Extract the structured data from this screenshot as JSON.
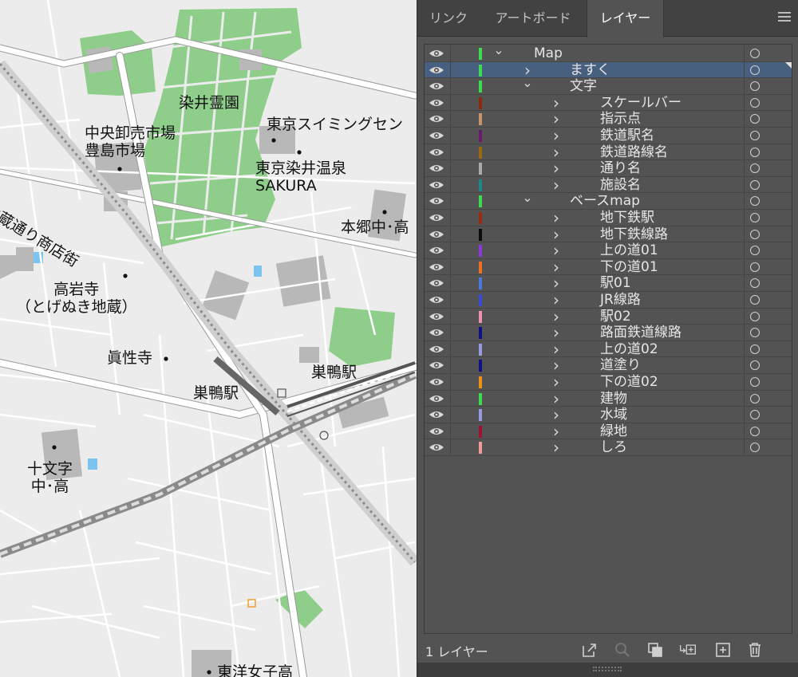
{
  "map": {
    "labels": {
      "somei_reien": "染井霊園",
      "tokyo_swimming": "東京スイミングセン",
      "chuo_oroshiuri": "中央卸売市場\n豊島市場",
      "tokyo_somei_onsen": "東京染井温泉\nSAKURA",
      "jizo_dori": "地蔵通り商店街",
      "hongo": "本郷中･高",
      "koganji": "高岩寺\n（とげぬき地蔵）",
      "shinshoji": "眞性寺",
      "sugamo_station_jr": "巣鴨駅",
      "sugamo_station_subway": "巣鴨駅",
      "jumonji": "十文字\n中･高",
      "toyo_joshi": "東洋女子高"
    }
  },
  "panel": {
    "tabs": [
      "リンク",
      "アートボード",
      "レイヤー"
    ],
    "active_tab": "レイヤー",
    "layer_count": "1 レイヤー",
    "layers": [
      {
        "name": "Map",
        "level": 0,
        "expanded": true,
        "color": "#3ddc4e",
        "selected": false
      },
      {
        "name": "ますく",
        "level": 1,
        "expanded": false,
        "color": "#3ddc4e",
        "selected": true
      },
      {
        "name": "文字",
        "level": 1,
        "expanded": true,
        "color": "#3ddc4e",
        "selected": false
      },
      {
        "name": "スケールバー",
        "level": 2,
        "expanded": false,
        "color": "#8b2a10",
        "selected": false
      },
      {
        "name": "指示点",
        "level": 2,
        "expanded": false,
        "color": "#c8926a",
        "selected": false
      },
      {
        "name": "鉄道駅名",
        "level": 2,
        "expanded": false,
        "color": "#6a1a6a",
        "selected": false
      },
      {
        "name": "鉄道路線名",
        "level": 2,
        "expanded": false,
        "color": "#9a6a10",
        "selected": false
      },
      {
        "name": "通り名",
        "level": 2,
        "expanded": false,
        "color": "#aaaaaa",
        "selected": false
      },
      {
        "name": "施設名",
        "level": 2,
        "expanded": false,
        "color": "#1a8a8a",
        "selected": false
      },
      {
        "name": "ベースmap",
        "level": 1,
        "expanded": true,
        "color": "#3ddc4e",
        "selected": false
      },
      {
        "name": "地下鉄駅",
        "level": 2,
        "expanded": false,
        "color": "#9a2a10",
        "selected": false
      },
      {
        "name": "地下鉄線路",
        "level": 2,
        "expanded": false,
        "color": "#0a0a0a",
        "selected": false
      },
      {
        "name": "上の道01",
        "level": 2,
        "expanded": false,
        "color": "#8a3ad8",
        "selected": false
      },
      {
        "name": "下の道01",
        "level": 2,
        "expanded": false,
        "color": "#f07020",
        "selected": false
      },
      {
        "name": "駅01",
        "level": 2,
        "expanded": false,
        "color": "#4a7ae0",
        "selected": false
      },
      {
        "name": "JR線路",
        "level": 2,
        "expanded": false,
        "color": "#3a4ad8",
        "selected": false
      },
      {
        "name": "駅02",
        "level": 2,
        "expanded": false,
        "color": "#f090b0",
        "selected": false
      },
      {
        "name": "路面鉄道線路",
        "level": 2,
        "expanded": false,
        "color": "#10108a",
        "selected": false
      },
      {
        "name": "上の道02",
        "level": 2,
        "expanded": false,
        "color": "#9a9ae0",
        "selected": false
      },
      {
        "name": "道塗り",
        "level": 2,
        "expanded": false,
        "color": "#10108a",
        "selected": false
      },
      {
        "name": "下の道02",
        "level": 2,
        "expanded": false,
        "color": "#f09010",
        "selected": false
      },
      {
        "name": "建物",
        "level": 2,
        "expanded": false,
        "color": "#3ddc4e",
        "selected": false
      },
      {
        "name": "水域",
        "level": 2,
        "expanded": false,
        "color": "#9a9ae0",
        "selected": false
      },
      {
        "name": "緑地",
        "level": 2,
        "expanded": false,
        "color": "#a01030",
        "selected": false
      },
      {
        "name": "しろ",
        "level": 2,
        "expanded": false,
        "color": "#f09a9a",
        "selected": false
      }
    ],
    "footer_icons": [
      "export-icon",
      "locate-object-icon",
      "clipping-mask-icon",
      "new-sublayer-icon",
      "new-layer-icon",
      "trash-icon"
    ],
    "panel_menu_icon": "hamburger-menu-icon"
  }
}
